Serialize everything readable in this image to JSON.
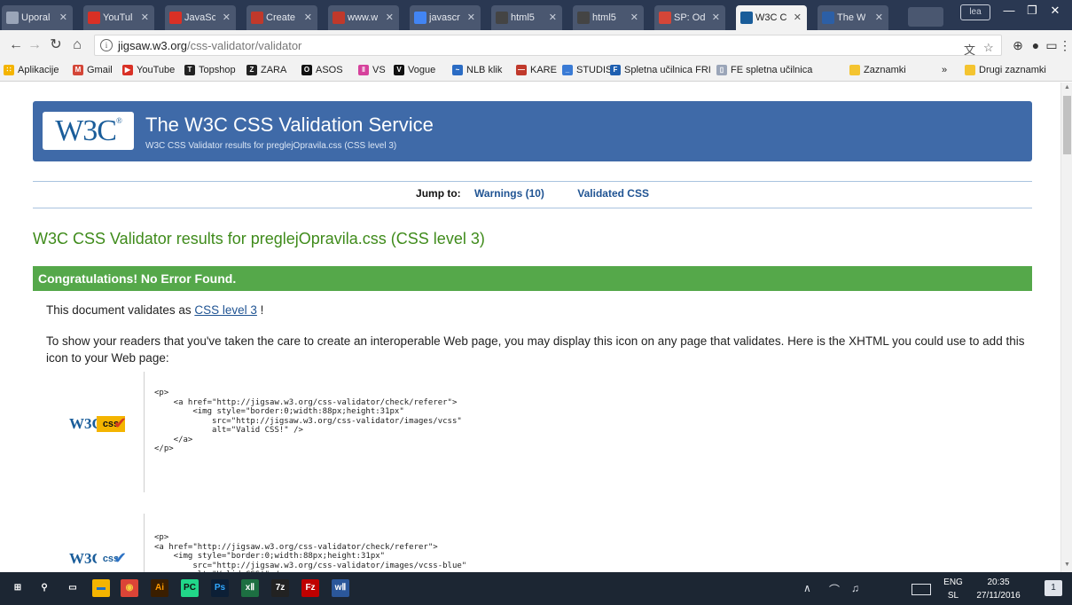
{
  "browser": {
    "tabs": [
      {
        "label": "Uporal",
        "favicon": "doc-icon",
        "color": "#9aa5b8"
      },
      {
        "label": "YouTul",
        "favicon": "youtube-icon",
        "color": "#d93025"
      },
      {
        "label": "JavaSc",
        "favicon": "youtube-icon",
        "color": "#d93025"
      },
      {
        "label": "Create",
        "favicon": "red-icon",
        "color": "#c0392b"
      },
      {
        "label": "www.w",
        "favicon": "red-icon",
        "color": "#c0392b"
      },
      {
        "label": "javascr",
        "favicon": "google-icon",
        "color": "#4285f4"
      },
      {
        "label": "html5",
        "favicon": "stackoverflow-icon",
        "color": "#444444"
      },
      {
        "label": "html5",
        "favicon": "stackoverflow-icon",
        "color": "#444444"
      },
      {
        "label": "SP: Od",
        "favicon": "gmail-icon",
        "color": "#d44638"
      },
      {
        "label": "W3C C",
        "favicon": "w3c-icon",
        "color": "#1a5d9a",
        "active": true
      },
      {
        "label": "The W",
        "favicon": "w3schools-icon",
        "color": "#2c5fa6"
      }
    ],
    "profile_label": "lea",
    "url_host": "jigsaw.w3.org",
    "url_path": "/css-validator/validator",
    "bookmarks": [
      {
        "label": "Aplikacije",
        "color": "#f4b400",
        "glyph": "∷"
      },
      {
        "label": "Gmail",
        "color": "#d44638",
        "glyph": "M"
      },
      {
        "label": "YouTube",
        "color": "#d93025",
        "glyph": "▶"
      },
      {
        "label": "Topshop",
        "color": "#222222",
        "glyph": "T"
      },
      {
        "label": "ZARA",
        "color": "#222222",
        "glyph": "Z"
      },
      {
        "label": "ASOS",
        "color": "#111111",
        "glyph": "O"
      },
      {
        "label": "VS",
        "color": "#d6429c",
        "glyph": "‖"
      },
      {
        "label": "Vogue",
        "color": "#111111",
        "glyph": "V"
      },
      {
        "label": "NLB klik",
        "color": "#2b6cc4",
        "glyph": "~"
      },
      {
        "label": "KARE",
        "color": "#c0392b",
        "glyph": "—"
      },
      {
        "label": "STUDIS",
        "color": "#3a7bd5",
        "glyph": "_"
      },
      {
        "label": "Spletna učilnica FRI",
        "color": "#1f5fb0",
        "glyph": "F"
      },
      {
        "label": "FE spletna učilnica",
        "color": "#9aa5b8",
        "glyph": "▯"
      },
      {
        "label": "Zaznamki",
        "color": "#f4c430",
        "glyph": ""
      },
      {
        "label": "Drugi zaznamki",
        "color": "#f4c430",
        "glyph": ""
      }
    ],
    "overflow_label": "»"
  },
  "page": {
    "banner_title": "The W3C CSS Validation Service",
    "banner_subtitle": "W3C CSS Validator results for preglejOpravila.css (CSS level 3)",
    "logo_text": "W3C",
    "jump_label": "Jump to:",
    "jump_warnings": "Warnings (10)",
    "jump_validated": "Validated CSS",
    "results_heading": "W3C CSS Validator results for preglejOpravila.css (CSS level 3)",
    "congrats": "Congratulations! No Error Found.",
    "validates_prefix": "This document validates as ",
    "validates_link": "CSS level 3",
    "validates_suffix": " !",
    "readers_text": "To show your readers that you've taken the care to create an interoperable Web page, you may display this icon on any page that validates. Here is the XHTML you could use to add this icon to your Web page:",
    "badge1": {
      "w3c": "W3C",
      "css": "css",
      "bg": "#f4b400",
      "text": "#1a5d9a",
      "check": "#d63b1f"
    },
    "badge2": {
      "w3c": "W3C",
      "css": "css",
      "bg": "#ffffff",
      "text": "#1a5d9a",
      "check": "#2d72c4"
    },
    "code1": "<p>\n    <a href=\"http://jigsaw.w3.org/css-validator/check/referer\">\n        <img style=\"border:0;width:88px;height:31px\"\n            src=\"http://jigsaw.w3.org/css-validator/images/vcss\"\n            alt=\"Valid CSS!\" />\n    </a>\n</p>",
    "code2": "<p>\n<a href=\"http://jigsaw.w3.org/css-validator/check/referer\">\n    <img style=\"border:0;width:88px;height:31px\"\n        src=\"http://jigsaw.w3.org/css-validator/images/vcss-blue\"\n        alt=\"Valid CSS!\" />"
  },
  "taskbar": {
    "apps": [
      {
        "name": "windows-start-icon",
        "glyph": "⊞",
        "color": "transparent",
        "fg": "#ffffff"
      },
      {
        "name": "search-icon",
        "glyph": "⚲",
        "color": "transparent",
        "fg": "#ffffff"
      },
      {
        "name": "task-view-icon",
        "glyph": "▭",
        "color": "transparent",
        "fg": "#ffffff"
      },
      {
        "name": "file-explorer-icon",
        "glyph": "▬",
        "color": "#f4b400",
        "fg": "#1e6fc2"
      },
      {
        "name": "chrome-icon",
        "glyph": "◉",
        "color": "#db4437",
        "fg": "#f4d03f"
      },
      {
        "name": "illustrator-icon",
        "glyph": "Ai",
        "color": "#3a1e00",
        "fg": "#ff9a00"
      },
      {
        "name": "pycharm-icon",
        "glyph": "PC",
        "color": "#21d789",
        "fg": "#111111"
      },
      {
        "name": "photoshop-icon",
        "glyph": "Ps",
        "color": "#0c1f36",
        "fg": "#31a8ff"
      },
      {
        "name": "excel-icon",
        "glyph": "xⅡ",
        "color": "#1d6f42",
        "fg": "#ffffff"
      },
      {
        "name": "7zip-icon",
        "glyph": "7z",
        "color": "#222222",
        "fg": "#ffffff"
      },
      {
        "name": "filezilla-icon",
        "glyph": "Fz",
        "color": "#bf0000",
        "fg": "#ffffff"
      },
      {
        "name": "word-icon",
        "glyph": "wⅡ",
        "color": "#2b579a",
        "fg": "#ffffff"
      }
    ],
    "lang_top": "ENG",
    "lang_bottom": "SL",
    "time": "20:35",
    "date": "27/11/2016",
    "notif_count": "1"
  }
}
